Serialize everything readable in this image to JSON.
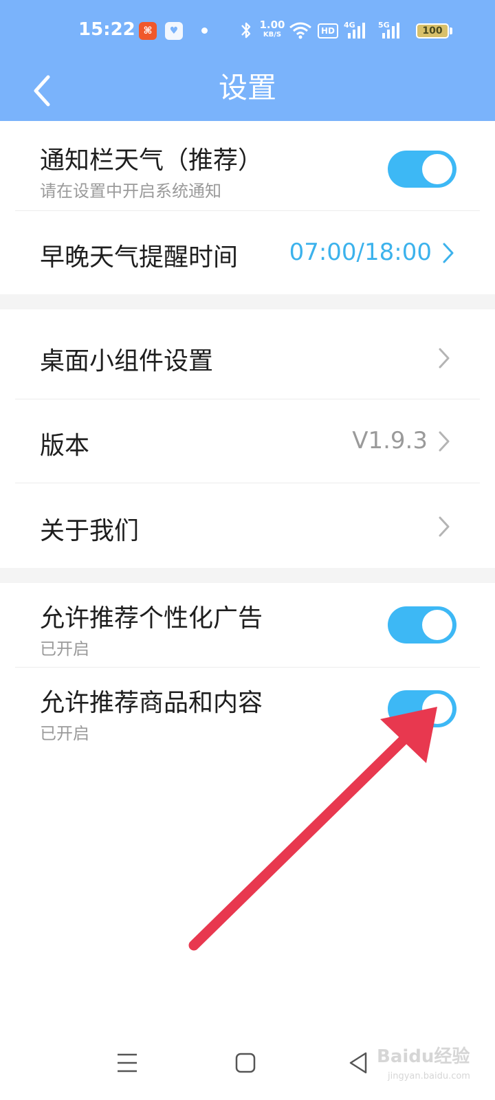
{
  "status_bar": {
    "time": "15:22",
    "net_speed_value": "1.00",
    "net_speed_unit": "KB/S",
    "hd_label": "HD",
    "sig1_label": "4G",
    "sig2_label": "5G",
    "battery": "100",
    "icons": [
      "app-badge-icon",
      "heart-app-icon",
      "bluetooth-icon",
      "wifi-icon",
      "signal-icon",
      "battery-icon"
    ]
  },
  "header": {
    "title": "设置",
    "back_icon": "chevron-left-icon"
  },
  "settings": {
    "notification_weather": {
      "title": "通知栏天气（推荐）",
      "subtitle": "请在设置中开启系统通知",
      "enabled": true
    },
    "reminder_time": {
      "title": "早晚天气提醒时间",
      "value": "07:00/18:00"
    },
    "widget_settings": {
      "title": "桌面小组件设置"
    },
    "version": {
      "title": "版本",
      "value": "V1.9.3"
    },
    "about_us": {
      "title": "关于我们"
    },
    "personalized_ads": {
      "title": "允许推荐个性化广告",
      "subtitle": "已开启",
      "enabled": true
    },
    "recommend_content": {
      "title": "允许推荐商品和内容",
      "subtitle": "已开启",
      "enabled": true
    }
  },
  "watermark": {
    "main": "Baidu经验",
    "sub": "jingyan.baidu.com"
  },
  "colors": {
    "header_bg": "#7ab3fb",
    "toggle_on": "#3db8f5",
    "accent_value": "#3cb2ec",
    "arrow": "#e8384f"
  }
}
